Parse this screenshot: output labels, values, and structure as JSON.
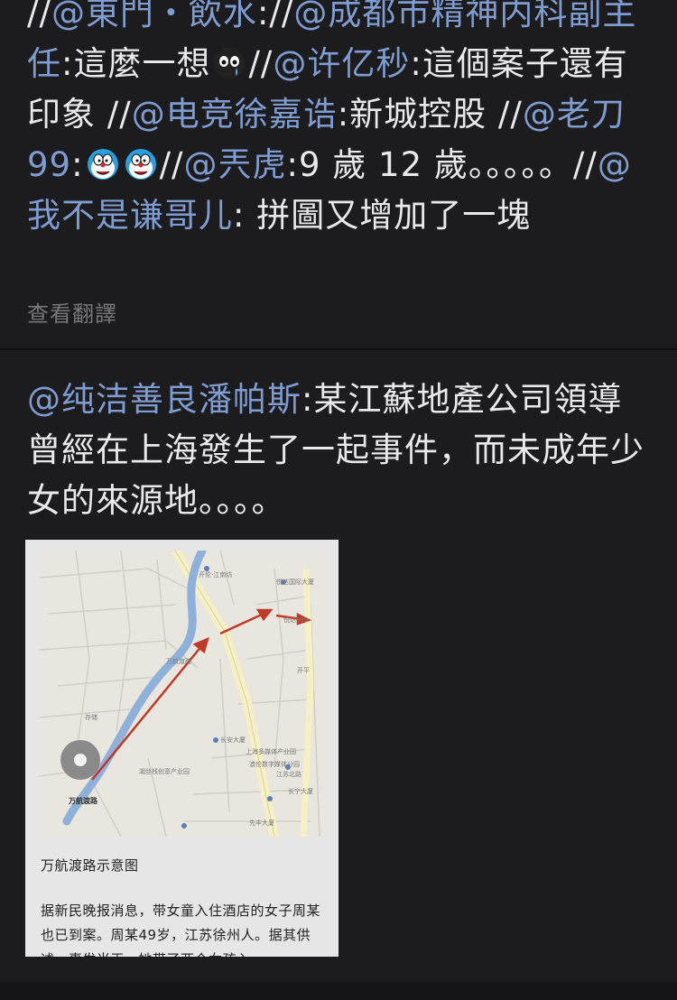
{
  "comment1": {
    "segments": [
      {
        "t": "//",
        "cls": "slash",
        "name": "separator-text"
      },
      {
        "t": "@東門・飲水",
        "cls": "mention",
        "name": "mention-link"
      },
      {
        "t": "://",
        "cls": "slash",
        "name": "separator-text"
      },
      {
        "t": "@成都市精神内科副主任",
        "cls": "mention",
        "name": "mention-link"
      },
      {
        "t": ":這麼一想",
        "cls": "plain",
        "name": "comment-text"
      },
      {
        "emoji": "crying-face",
        "name": "crying-face-emoji-icon"
      },
      {
        "t": "//",
        "cls": "slash",
        "name": "separator-text"
      },
      {
        "t": "@许亿秒",
        "cls": "mention",
        "name": "mention-link"
      },
      {
        "t": ":這個案子還有印象 //",
        "cls": "plain",
        "name": "comment-text"
      },
      {
        "t": "@电竞徐嘉诰",
        "cls": "mention",
        "name": "mention-link"
      },
      {
        "t": ":新城控股 //",
        "cls": "plain",
        "name": "comment-text"
      },
      {
        "t": "@老刀99",
        "cls": "mention",
        "name": "mention-link"
      },
      {
        "t": ":",
        "cls": "plain",
        "name": "comment-text"
      },
      {
        "emoji": "doraemon",
        "name": "doraemon-emoji-icon"
      },
      {
        "emoji": "doraemon",
        "name": "doraemon-emoji-icon"
      },
      {
        "t": "//",
        "cls": "slash",
        "name": "separator-text"
      },
      {
        "t": "@兲虎",
        "cls": "mention",
        "name": "mention-link"
      },
      {
        "t": ":9 歲 12 歲。。。。。//",
        "cls": "plain",
        "name": "comment-text"
      },
      {
        "t": "@我不是谦哥儿",
        "cls": "mention",
        "name": "mention-link"
      },
      {
        "t": ": 拼圖又增加了一塊",
        "cls": "plain",
        "name": "comment-text"
      }
    ],
    "translate_label": "查看翻譯"
  },
  "comment2": {
    "segments": [
      {
        "t": "@纯洁善良潘帕斯",
        "cls": "mention",
        "name": "mention-link"
      },
      {
        "t": ":某江蘇地產公司領導曾經在上海發生了一起事件，而未成年少女的來源地。。。。",
        "cls": "plain",
        "name": "comment-text"
      }
    ]
  },
  "news_image": {
    "map_labels": [
      "开伦·江南坊",
      "悦达国际大厦",
      "悦达889",
      "开平",
      "万航渡路",
      "长安大厦",
      "上海多媒体产业园",
      "澳伦数字媒体分园",
      "江苏北路",
      "湖丝栈创意产业园",
      "长宁大厦",
      "先丰大厦",
      "存储",
      "万航渡路"
    ],
    "caption": "万航渡路示意图",
    "body": "据新民晚报消息，带女童入住酒店的女子周某也已到案。周某49岁，江苏徐州人。据其供述，事发当天，她带了两个女孩入"
  },
  "colors": {
    "mention": "#7f9cd0",
    "card": "#1c1c1e",
    "background": "#101012",
    "arrow": "#c0392b"
  }
}
